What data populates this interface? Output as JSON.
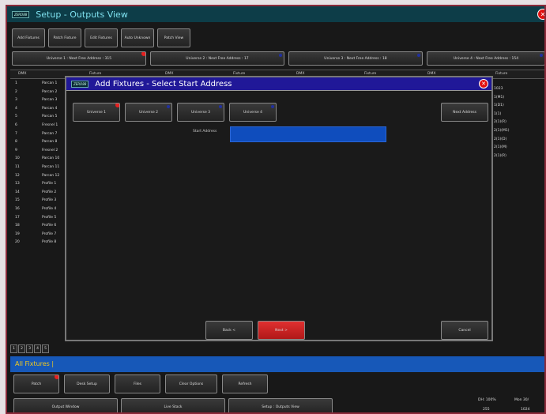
{
  "window": {
    "logo": "ZERO88",
    "title": "Setup - Outputs View"
  },
  "toolbar": [
    "Add Fixtures",
    "Patch Fixture",
    "Edit Fixtures",
    "Auto Unknown",
    "Patch View"
  ],
  "universe_tabs": [
    "Universe 1 : Next Free Address : 315",
    "Universe 2 : Next Free Address : 17",
    "Universe 3 : Next Free Address : 18",
    "Universe 4 : Next Free Address : 154"
  ],
  "table": {
    "headers": [
      "DMX",
      "Fixture",
      "DMX",
      "Fixture",
      "DMX",
      "Fixture",
      "DMX",
      "Fixture"
    ],
    "rows": [
      {
        "num": "1",
        "fixture": "Parcan 1"
      },
      {
        "num": "2",
        "fixture": "Parcan 2"
      },
      {
        "num": "3",
        "fixture": "Parcan 3"
      },
      {
        "num": "4",
        "fixture": "Parcan 4"
      },
      {
        "num": "5",
        "fixture": "Parcan 5"
      },
      {
        "num": "6",
        "fixture": "Fresnel 1"
      },
      {
        "num": "7",
        "fixture": "Parcan 7"
      },
      {
        "num": "8",
        "fixture": "Parcan 8"
      },
      {
        "num": "9",
        "fixture": "Fresnel 2"
      },
      {
        "num": "10",
        "fixture": "Parcan 10"
      },
      {
        "num": "11",
        "fixture": "Parcan 11"
      },
      {
        "num": "12",
        "fixture": "Parcan 12"
      },
      {
        "num": "13",
        "fixture": "Profile 1"
      },
      {
        "num": "14",
        "fixture": "Profile 2"
      },
      {
        "num": "15",
        "fixture": "Profile 3"
      },
      {
        "num": "16",
        "fixture": "Profile 4"
      },
      {
        "num": "17",
        "fixture": "Profile 5"
      },
      {
        "num": "18",
        "fixture": "Profile 6"
      },
      {
        "num": "19",
        "fixture": "Profile 7"
      },
      {
        "num": "20",
        "fixture": "Profile 8"
      }
    ],
    "right_column": [
      "1023",
      "1(M1)",
      "1(D1)",
      "1(1)",
      "2(1)(R)",
      "2(1)(M1)",
      "2(1)(D)",
      "2(1)(M)",
      "2(1)(R)"
    ]
  },
  "pages": [
    "1",
    "2",
    "3",
    "4",
    "5"
  ],
  "selection": "All Fixtures |",
  "bottom_toolbar": [
    "Patch",
    "Desk Setup",
    "Files",
    "Clear Options",
    "Refresh"
  ],
  "bottom_tabs": [
    "Output Window",
    "Live Stack",
    "Setup : Outputs View"
  ],
  "status": {
    "line1": "DH: 100%",
    "time": "Mon 30/",
    "line2": "255",
    "line3": "1024"
  },
  "dialog": {
    "logo": "ZERO88",
    "title": "Add Fixtures - Select Start Address",
    "universes": [
      "Universe 1",
      "Universe 2",
      "Universe 3",
      "Universe 4"
    ],
    "next_address": "Next Address",
    "field_label": "Start Address",
    "field_value": "",
    "back": "Back <",
    "next": "Next >",
    "cancel": "Cancel"
  }
}
